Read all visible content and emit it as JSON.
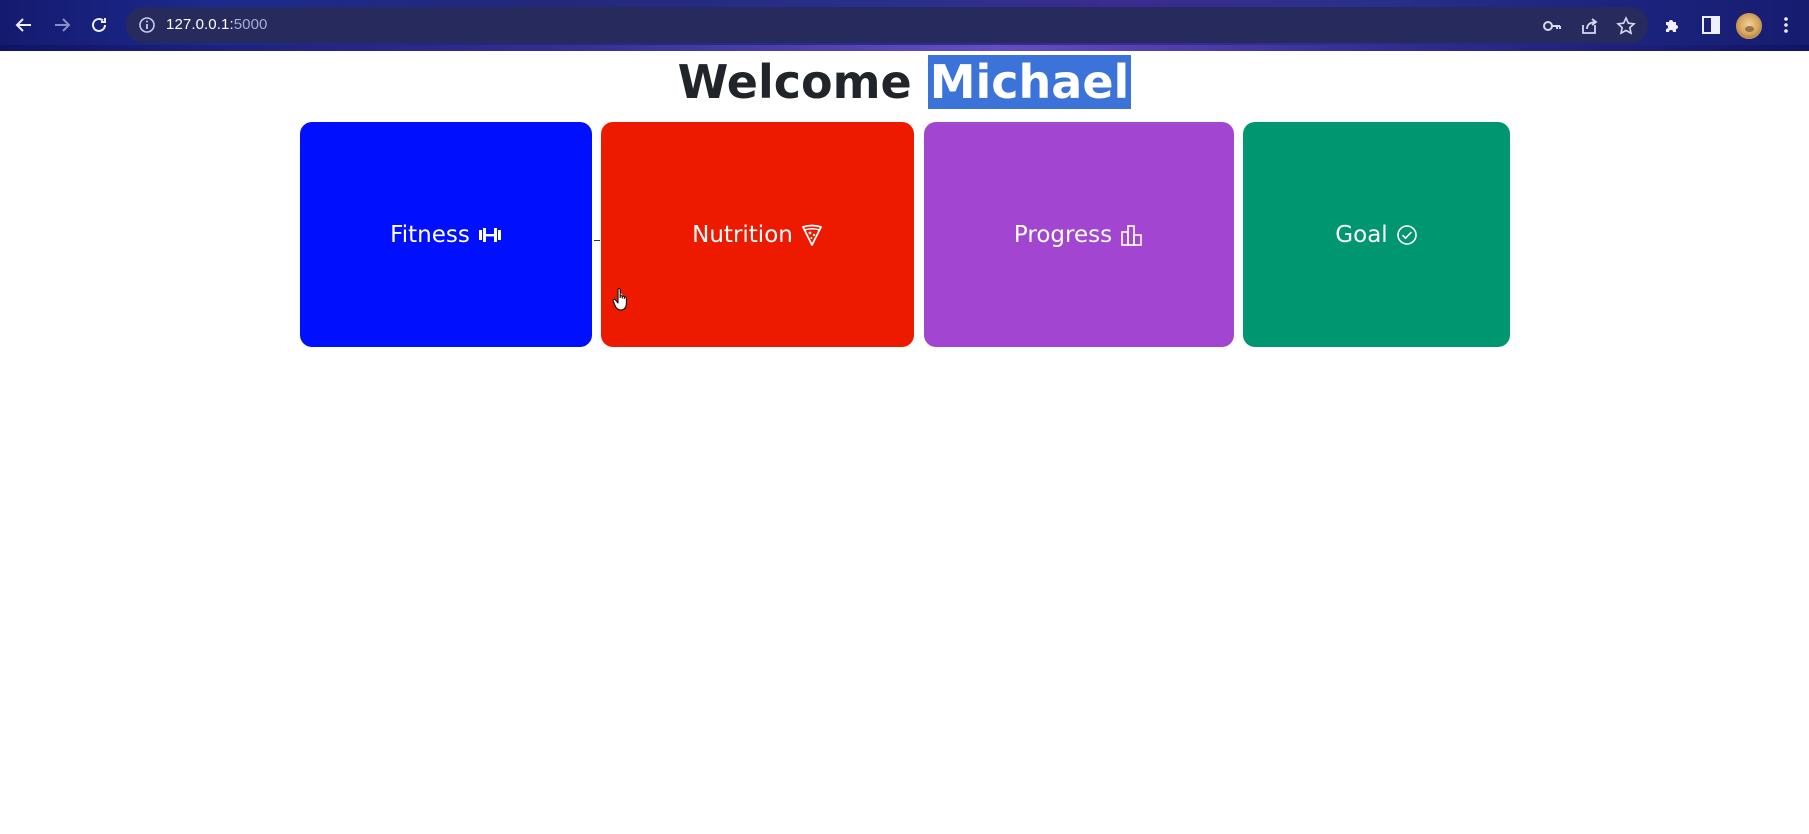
{
  "browser": {
    "url_host": "127.0.0.1:",
    "url_port": "5000",
    "icons": [
      "back-icon",
      "forward-icon",
      "reload-icon",
      "info-icon",
      "key-icon",
      "share-icon",
      "star-icon",
      "extensions-icon",
      "sidepanel-icon",
      "profile-avatar",
      "menu-icon"
    ]
  },
  "page": {
    "welcome_text": "Welcome",
    "user_name": "Michael"
  },
  "cards": [
    {
      "label": "Fitness",
      "icon": "dumbbell-icon",
      "color": "#0010ff"
    },
    {
      "label": "Nutrition",
      "icon": "pizza-icon",
      "color": "#ee1a00"
    },
    {
      "label": "Progress",
      "icon": "bar-chart-icon",
      "color": "#a246d2"
    },
    {
      "label": "Goal",
      "icon": "check-circle-icon",
      "color": "#009670"
    }
  ]
}
